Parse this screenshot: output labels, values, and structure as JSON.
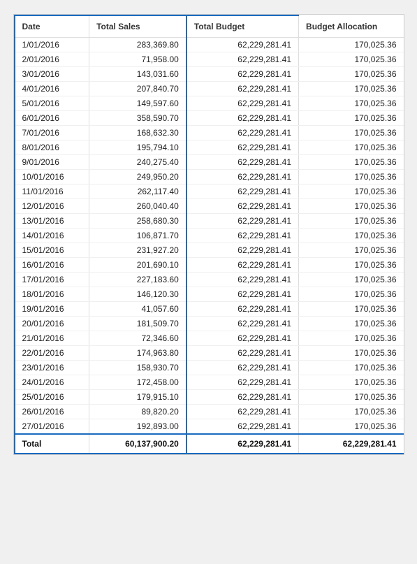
{
  "table": {
    "columns": {
      "date": "Date",
      "total_sales": "Total Sales",
      "total_budget": "Total Budget",
      "budget_allocation": "Budget Allocation"
    },
    "rows": [
      {
        "date": "1/01/2016",
        "total_sales": "283,369.80",
        "total_budget": "62,229,281.41",
        "budget_allocation": "170,025.36"
      },
      {
        "date": "2/01/2016",
        "total_sales": "71,958.00",
        "total_budget": "62,229,281.41",
        "budget_allocation": "170,025.36"
      },
      {
        "date": "3/01/2016",
        "total_sales": "143,031.60",
        "total_budget": "62,229,281.41",
        "budget_allocation": "170,025.36"
      },
      {
        "date": "4/01/2016",
        "total_sales": "207,840.70",
        "total_budget": "62,229,281.41",
        "budget_allocation": "170,025.36"
      },
      {
        "date": "5/01/2016",
        "total_sales": "149,597.60",
        "total_budget": "62,229,281.41",
        "budget_allocation": "170,025.36"
      },
      {
        "date": "6/01/2016",
        "total_sales": "358,590.70",
        "total_budget": "62,229,281.41",
        "budget_allocation": "170,025.36"
      },
      {
        "date": "7/01/2016",
        "total_sales": "168,632.30",
        "total_budget": "62,229,281.41",
        "budget_allocation": "170,025.36"
      },
      {
        "date": "8/01/2016",
        "total_sales": "195,794.10",
        "total_budget": "62,229,281.41",
        "budget_allocation": "170,025.36"
      },
      {
        "date": "9/01/2016",
        "total_sales": "240,275.40",
        "total_budget": "62,229,281.41",
        "budget_allocation": "170,025.36"
      },
      {
        "date": "10/01/2016",
        "total_sales": "249,950.20",
        "total_budget": "62,229,281.41",
        "budget_allocation": "170,025.36"
      },
      {
        "date": "11/01/2016",
        "total_sales": "262,117.40",
        "total_budget": "62,229,281.41",
        "budget_allocation": "170,025.36"
      },
      {
        "date": "12/01/2016",
        "total_sales": "260,040.40",
        "total_budget": "62,229,281.41",
        "budget_allocation": "170,025.36"
      },
      {
        "date": "13/01/2016",
        "total_sales": "258,680.30",
        "total_budget": "62,229,281.41",
        "budget_allocation": "170,025.36"
      },
      {
        "date": "14/01/2016",
        "total_sales": "106,871.70",
        "total_budget": "62,229,281.41",
        "budget_allocation": "170,025.36"
      },
      {
        "date": "15/01/2016",
        "total_sales": "231,927.20",
        "total_budget": "62,229,281.41",
        "budget_allocation": "170,025.36"
      },
      {
        "date": "16/01/2016",
        "total_sales": "201,690.10",
        "total_budget": "62,229,281.41",
        "budget_allocation": "170,025.36"
      },
      {
        "date": "17/01/2016",
        "total_sales": "227,183.60",
        "total_budget": "62,229,281.41",
        "budget_allocation": "170,025.36"
      },
      {
        "date": "18/01/2016",
        "total_sales": "146,120.30",
        "total_budget": "62,229,281.41",
        "budget_allocation": "170,025.36"
      },
      {
        "date": "19/01/2016",
        "total_sales": "41,057.60",
        "total_budget": "62,229,281.41",
        "budget_allocation": "170,025.36"
      },
      {
        "date": "20/01/2016",
        "total_sales": "181,509.70",
        "total_budget": "62,229,281.41",
        "budget_allocation": "170,025.36"
      },
      {
        "date": "21/01/2016",
        "total_sales": "72,346.60",
        "total_budget": "62,229,281.41",
        "budget_allocation": "170,025.36"
      },
      {
        "date": "22/01/2016",
        "total_sales": "174,963.80",
        "total_budget": "62,229,281.41",
        "budget_allocation": "170,025.36"
      },
      {
        "date": "23/01/2016",
        "total_sales": "158,930.70",
        "total_budget": "62,229,281.41",
        "budget_allocation": "170,025.36"
      },
      {
        "date": "24/01/2016",
        "total_sales": "172,458.00",
        "total_budget": "62,229,281.41",
        "budget_allocation": "170,025.36"
      },
      {
        "date": "25/01/2016",
        "total_sales": "179,915.10",
        "total_budget": "62,229,281.41",
        "budget_allocation": "170,025.36"
      },
      {
        "date": "26/01/2016",
        "total_sales": "89,820.20",
        "total_budget": "62,229,281.41",
        "budget_allocation": "170,025.36"
      },
      {
        "date": "27/01/2016",
        "total_sales": "192,893.00",
        "total_budget": "62,229,281.41",
        "budget_allocation": "170,025.36"
      }
    ],
    "footer": {
      "label": "Total",
      "total_sales": "60,137,900.20",
      "total_budget": "62,229,281.41",
      "budget_allocation": "62,229,281.41"
    }
  }
}
